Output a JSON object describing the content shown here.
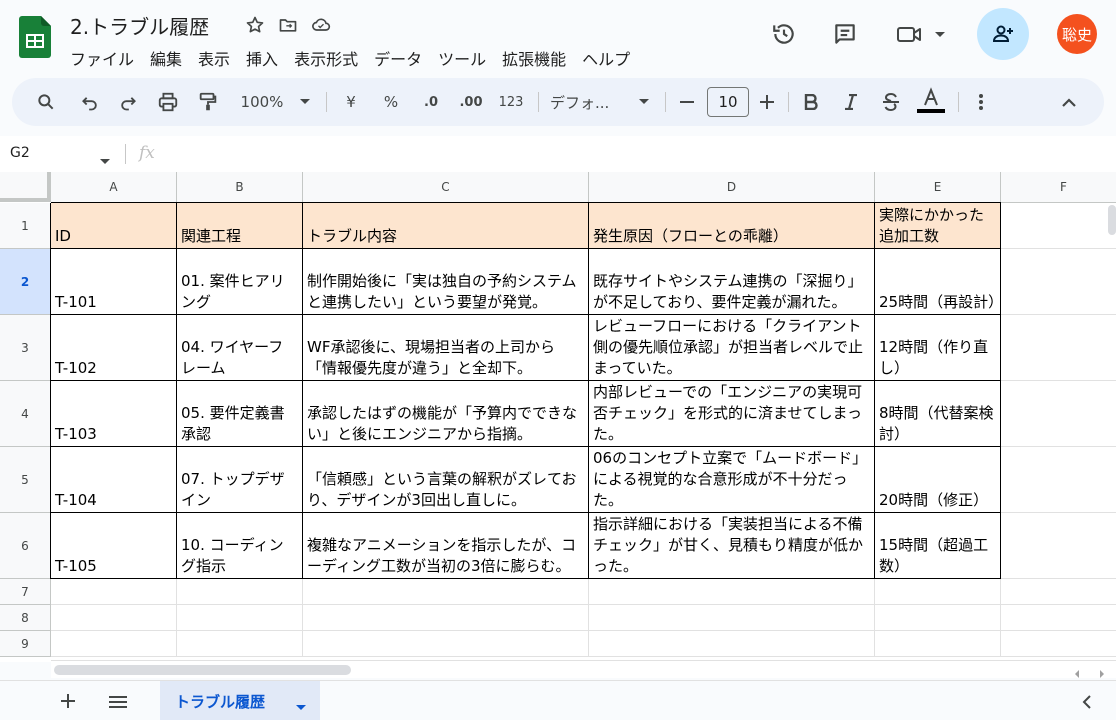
{
  "header": {
    "title": "2.トラブル履歴",
    "menu": [
      "ファイル",
      "編集",
      "表示",
      "挿入",
      "表示形式",
      "データ",
      "ツール",
      "拡張機能",
      "ヘルプ"
    ],
    "avatar_text": "聡史"
  },
  "toolbar": {
    "zoom": "100%",
    "currency": "¥",
    "percent": "%",
    "decimal_decrease": ".0",
    "decimal_increase": ".00",
    "number_format": "123",
    "font": "デフォ...",
    "font_size": "10",
    "minus": "—",
    "plus": "+"
  },
  "formula_bar": {
    "cell_ref": "G2",
    "fx": "fx",
    "content": ""
  },
  "columns": [
    "A",
    "B",
    "C",
    "D",
    "E",
    "F"
  ],
  "rows": [
    "1",
    "2",
    "3",
    "4",
    "5",
    "6",
    "7",
    "8",
    "9"
  ],
  "selected_row": "2",
  "table": {
    "headers": [
      "ID",
      "関連工程",
      "トラブル内容",
      "発生原因（フローとの乖離）",
      "実際にかかった追加工数"
    ],
    "rows": [
      [
        "T-101",
        "01. 案件ヒアリング",
        "制作開始後に「実は独自の予約システムと連携したい」という要望が発覚。",
        "既存サイトやシステム連携の「深掘り」が不足しており、要件定義が漏れた。",
        "25時間（再設計）"
      ],
      [
        "T-102",
        "04. ワイヤーフレーム",
        "WF承認後に、現場担当者の上司から「情報優先度が違う」と全却下。",
        "レビューフローにおける「クライアント側の優先順位承認」が担当者レベルで止まっていた。",
        "12時間（作り直し）"
      ],
      [
        "T-103",
        "05. 要件定義書承認",
        "承認したはずの機能が「予算内でできない」と後にエンジニアから指摘。",
        "内部レビューでの「エンジニアの実現可否チェック」を形式的に済ませてしまった。",
        "8時間（代替案検討）"
      ],
      [
        "T-104",
        "07. トップデザイン",
        "「信頼感」という言葉の解釈がズレており、デザインが3回出し直しに。",
        "06のコンセプト立案で「ムードボード」による視覚的な合意形成が不十分だった。",
        "20時間（修正）"
      ],
      [
        "T-105",
        "10. コーディング指示",
        "複雑なアニメーションを指示したが、コーディング工数が当初の3倍に膨らむ。",
        "指示詳細における「実装担当による不備チェック」が甘く、見積もり精度が低かった。",
        "15時間（超過工数）"
      ]
    ]
  },
  "sheet_tab": "トラブル履歴",
  "colors": {
    "header_fill": "#fde5cf",
    "accent": "#0b57d0",
    "avatar": "#f4511e",
    "sheets_green": "#188038"
  }
}
